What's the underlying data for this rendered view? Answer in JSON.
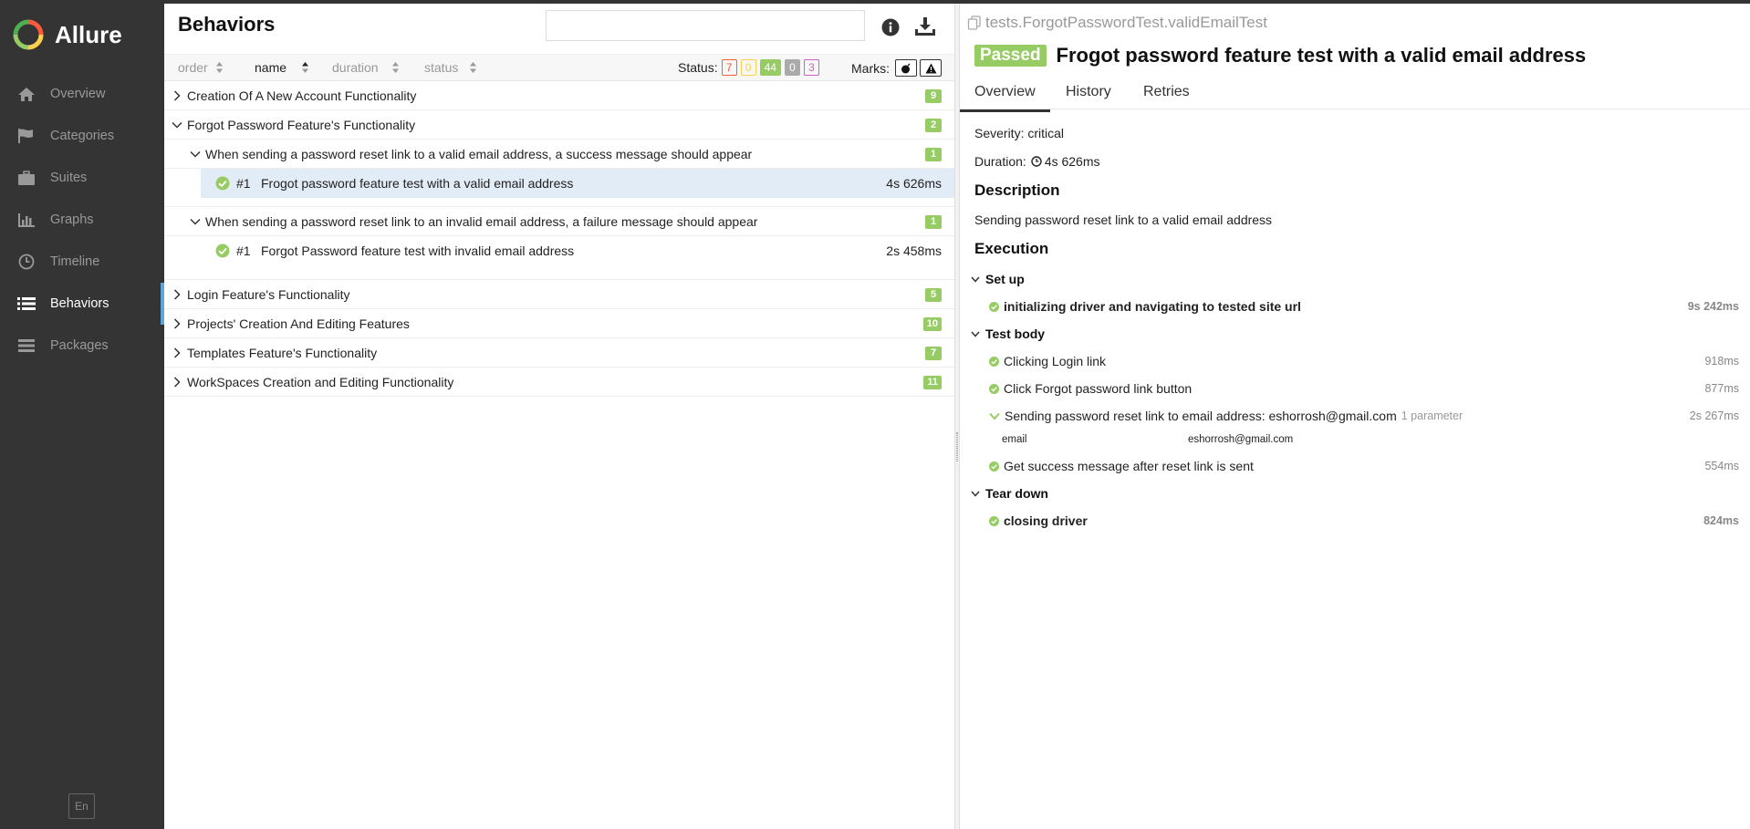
{
  "app": {
    "name": "Allure"
  },
  "sidebar": {
    "items": [
      {
        "label": "Overview",
        "icon": "home-icon"
      },
      {
        "label": "Categories",
        "icon": "flag-icon"
      },
      {
        "label": "Suites",
        "icon": "briefcase-icon"
      },
      {
        "label": "Graphs",
        "icon": "bar-chart-icon"
      },
      {
        "label": "Timeline",
        "icon": "clock-icon"
      },
      {
        "label": "Behaviors",
        "icon": "list-icon",
        "active": true
      },
      {
        "label": "Packages",
        "icon": "stack-icon"
      }
    ],
    "language": "En"
  },
  "behaviors": {
    "title": "Behaviors",
    "search": {
      "value": "",
      "placeholder": ""
    },
    "sorter": {
      "order": "order",
      "name": "name",
      "duration": "duration",
      "status": "status"
    },
    "status_label": "Status:",
    "status_counts": {
      "failed": "7",
      "broken": "0",
      "passed": "44",
      "skipped": "0",
      "unknown": "3"
    },
    "marks_label": "Marks:",
    "features": [
      {
        "name": "Creation Of A New Account Functionality",
        "count": "9"
      },
      {
        "name": "Forgot Password Feature's Functionality",
        "count": "2"
      },
      {
        "name": "Login Feature's Functionality",
        "count": "5"
      },
      {
        "name": "Projects' Creation And Editing Features",
        "count": "10"
      },
      {
        "name": "Templates Feature's Functionality",
        "count": "7"
      },
      {
        "name": "WorkSpaces Creation and Editing Functionality",
        "count": "11"
      }
    ],
    "stories": [
      {
        "name": "When sending a password reset link to a valid email address, a success message should appear",
        "count": "1",
        "test": {
          "num": "#1",
          "name": "Frogot password feature test with a valid email address",
          "duration": "4s 626ms"
        }
      },
      {
        "name": "When sending a password reset link to an invalid email address, a failure message should appear",
        "count": "1",
        "test": {
          "num": "#1",
          "name": "Forgot Password feature test with invalid email address",
          "duration": "2s 458ms"
        }
      }
    ]
  },
  "test": {
    "path": "tests.ForgotPasswordTest.validEmailTest",
    "status": "Passed",
    "title": "Frogot password feature test with a valid email address",
    "tabs": [
      "Overview",
      "History",
      "Retries"
    ],
    "severity": "Severity: critical",
    "duration_label": "Duration:",
    "duration": "4s 626ms",
    "description_header": "Description",
    "description": "Sending password reset link to a valid email address",
    "execution_header": "Execution",
    "setup": {
      "label": "Set up",
      "steps": [
        {
          "name": "initializing driver and navigating to tested site url",
          "duration": "9s 242ms"
        }
      ]
    },
    "body": {
      "label": "Test body",
      "steps": [
        {
          "name": "Clicking Login link",
          "duration": "918ms"
        },
        {
          "name": "Click Forgot password link button",
          "duration": "877ms"
        },
        {
          "name": "Sending password reset link to email address: eshorrosh@gmail.com",
          "duration": "2s 267ms",
          "hint": "1 parameter"
        },
        {
          "name": "Get success message after reset link is sent",
          "duration": "554ms"
        }
      ],
      "param": {
        "name": "email",
        "value": "eshorrosh@gmail.com"
      }
    },
    "teardown": {
      "label": "Tear down",
      "steps": [
        {
          "name": "closing driver",
          "duration": "824ms"
        }
      ]
    }
  },
  "colors": {
    "passed": "#97cc64",
    "failed": "#fd5a3e",
    "broken": "#ffd050",
    "skipped": "#aaaaaa",
    "unknown": "#d35ebe",
    "sidebar": "#343434",
    "accent": "#5ea5d9"
  }
}
